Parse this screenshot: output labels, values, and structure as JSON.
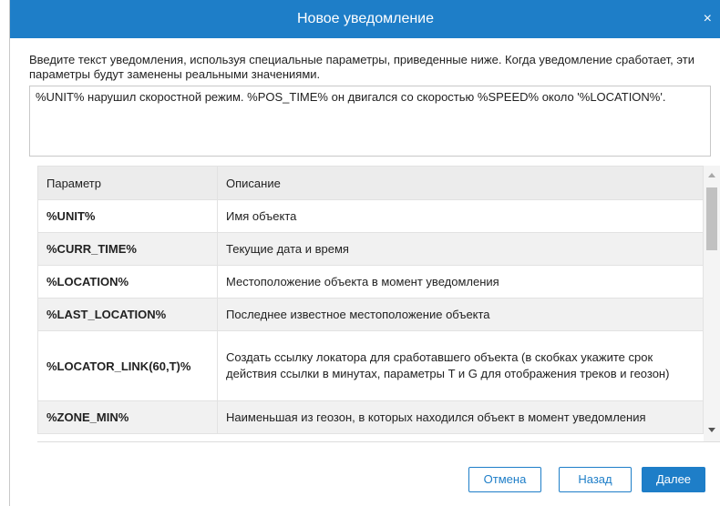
{
  "dialog": {
    "title": "Новое уведомление",
    "close_glyph": "×",
    "intro_text": "Введите текст уведомления, используя специальные параметры, приведенные ниже. Когда уведомление сработает, эти параметры будут заменены реальными значениями.",
    "message_text": "%UNIT% нарушил скоростной режим. %POS_TIME% он двигался со скоростью %SPEED% около '%LOCATION%'."
  },
  "table": {
    "headers": {
      "param": "Параметр",
      "desc": "Описание"
    },
    "rows": [
      {
        "param": "%UNIT%",
        "desc": "Имя объекта"
      },
      {
        "param": "%CURR_TIME%",
        "desc": "Текущие дата и время"
      },
      {
        "param": "%LOCATION%",
        "desc": "Местоположение объекта в момент уведомления"
      },
      {
        "param": "%LAST_LOCATION%",
        "desc": "Последнее известное местоположение объекта"
      },
      {
        "param": "%LOCATOR_LINK(60,T)%",
        "desc": "Создать ссылку локатора для сработавшего объекта (в скобках укажите срок действия ссылки в минутах, параметры T и G для отображения треков и геозон)"
      },
      {
        "param": "%ZONE_MIN%",
        "desc": "Наименьшая из геозон, в которых находился объект в момент уведомления"
      }
    ]
  },
  "buttons": {
    "cancel": "Отмена",
    "back": "Назад",
    "next": "Далее"
  },
  "colors": {
    "accent": "#1e7ec8",
    "row_alt": "#f1f1f1",
    "header_bg": "#ececec"
  },
  "icons": {
    "close": "close-icon",
    "scroll_up": "scroll-up-arrow-icon",
    "scroll_down": "scroll-down-arrow-icon"
  }
}
